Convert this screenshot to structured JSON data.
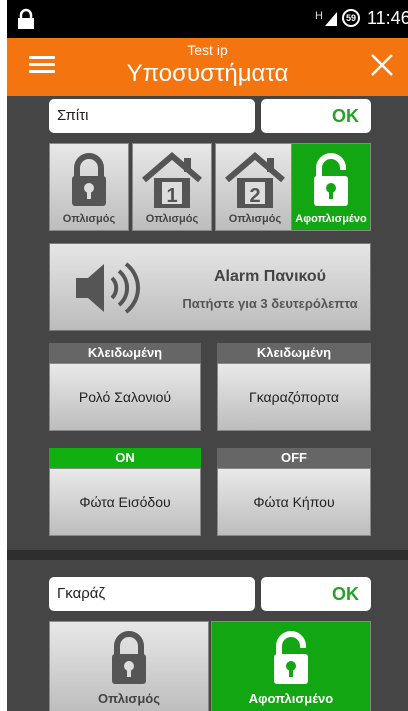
{
  "status_bar": {
    "signal": "H",
    "battery": "59",
    "time": "11:46"
  },
  "app_bar": {
    "subtitle": "Test ip",
    "title": "Υποσυστήματα"
  },
  "partitions": [
    {
      "name_value": "Σπίτι",
      "ok_label": "OK",
      "modes": [
        {
          "label": "Οπλισμός",
          "icon": "lock-closed-icon",
          "active": false
        },
        {
          "label": "Οπλισμός",
          "icon": "house-1-icon",
          "number": "1",
          "active": false
        },
        {
          "label": "Οπλισμός",
          "icon": "house-2-icon",
          "number": "2",
          "active": false
        },
        {
          "label": "Αφοπλισμένο",
          "icon": "lock-open-icon",
          "active": true
        }
      ],
      "panic": {
        "title": "Alarm Πανικού",
        "subtitle": "Πατήστε για 3 δευτερόλεπτα",
        "icon": "speaker-icon"
      },
      "controls": [
        {
          "status": "Κλειδωμένη",
          "label": "Ρολό Σαλονιού",
          "status_color": "#666666"
        },
        {
          "status": "Κλειδωμένη",
          "label": "Γκαραζόπορτα",
          "status_color": "#666666"
        },
        {
          "status": "ON",
          "label": "Φώτα Εισόδου",
          "status_color": "#10b010"
        },
        {
          "status": "OFF",
          "label": "Φώτα Κήπου",
          "status_color": "#666666"
        }
      ]
    },
    {
      "name_value": "Γκαράζ",
      "ok_label": "OK",
      "modes": [
        {
          "label": "Οπλισμός",
          "icon": "lock-closed-icon",
          "active": false
        },
        {
          "label": "Αφοπλισμένο",
          "icon": "lock-open-icon",
          "active": true
        }
      ]
    }
  ],
  "colors": {
    "accent": "#f4740f",
    "active_green": "#12a612",
    "ok_green": "#27a12a"
  }
}
